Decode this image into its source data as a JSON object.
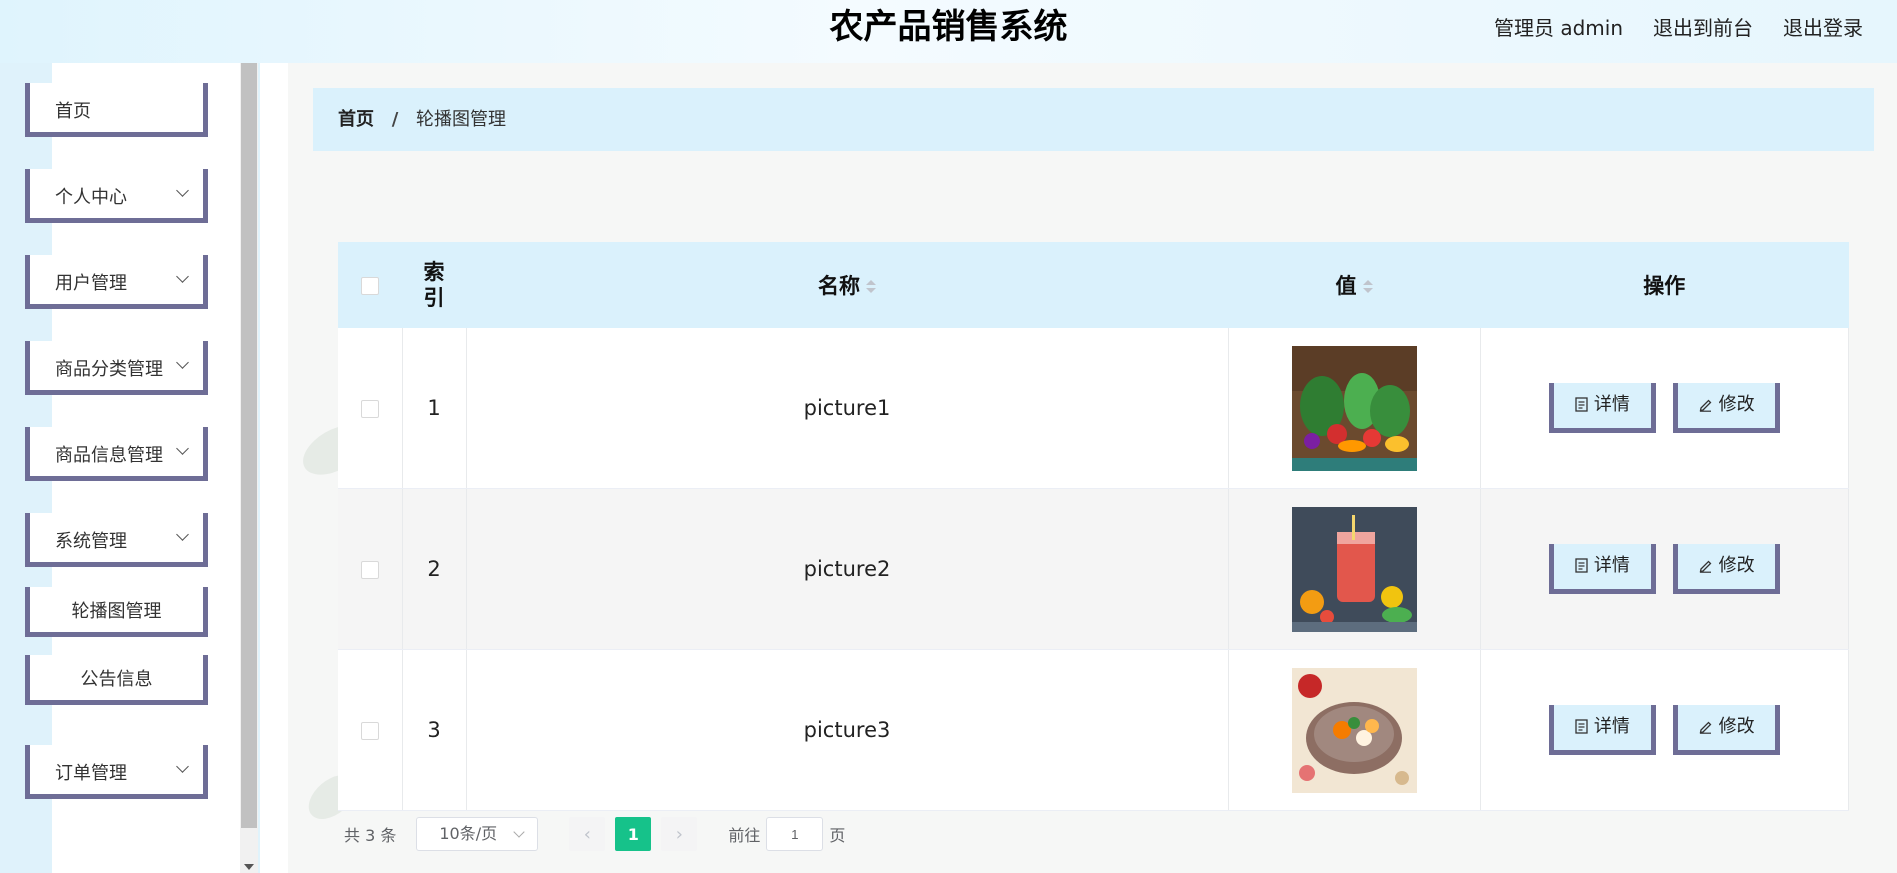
{
  "header": {
    "title": "农产品销售系统",
    "user_label": "管理员 admin",
    "front_link": "退出到前台",
    "logout_link": "退出登录"
  },
  "sidebar": {
    "items": [
      {
        "label": "首页"
      },
      {
        "label": "个人中心"
      },
      {
        "label": "用户管理"
      },
      {
        "label": "商品分类管理"
      },
      {
        "label": "商品信息管理"
      },
      {
        "label": "系统管理"
      },
      {
        "label": "轮播图管理"
      },
      {
        "label": "公告信息"
      },
      {
        "label": "订单管理"
      }
    ]
  },
  "breadcrumb": {
    "home": "首页",
    "separator": "/",
    "current": "轮播图管理"
  },
  "table": {
    "headers": {
      "index": "索引",
      "name": "名称",
      "value": "值",
      "actions": "操作"
    },
    "rows": [
      {
        "index": "1",
        "name": "picture1",
        "value_image": "vegetables-image"
      },
      {
        "index": "2",
        "name": "picture2",
        "value_image": "juice-image"
      },
      {
        "index": "3",
        "name": "picture3",
        "value_image": "stew-pot-image"
      }
    ],
    "detail_label": "详情",
    "edit_label": "修改"
  },
  "pagination": {
    "total": "共 3 条",
    "page_size": "10条/页",
    "current_page": "1",
    "goto_label": "前往",
    "goto_value": "1",
    "page_unit": "页"
  },
  "colors": {
    "accent_green": "#16c28a",
    "header_blue": "#daf1fc",
    "border_purple": "#6e6d96"
  }
}
